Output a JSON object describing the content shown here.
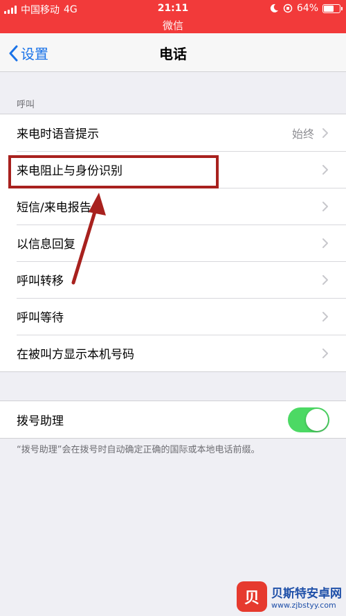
{
  "status_bar": {
    "carrier": "中国移动",
    "network": "4G",
    "time": "21:11",
    "subtitle": "微信",
    "battery": "64%",
    "battery_level": 0.64
  },
  "nav": {
    "back_label": "设置",
    "title": "电话"
  },
  "section_call": {
    "header": "呼叫",
    "items": [
      {
        "label": "来电时语音提示",
        "value": "始终"
      },
      {
        "label": "来电阻止与身份识别"
      },
      {
        "label": "短信/来电报告"
      },
      {
        "label": "以信息回复"
      },
      {
        "label": "呼叫转移"
      },
      {
        "label": "呼叫等待"
      },
      {
        "label": "在被叫方显示本机号码"
      }
    ]
  },
  "dial_assist": {
    "label": "拨号助理",
    "enabled": true,
    "footnote": "“拨号助理”会在拨号时自动确定正确的国际或本地电话前缀。"
  },
  "watermark": {
    "logo_char": "贝",
    "title": "贝斯特安卓网",
    "url": "www.zjbstyy.com"
  },
  "colors": {
    "status_bar": "#f23a3a",
    "accent": "#1a73e8",
    "toggle_on": "#4cd964",
    "annotation": "#a8211e"
  }
}
